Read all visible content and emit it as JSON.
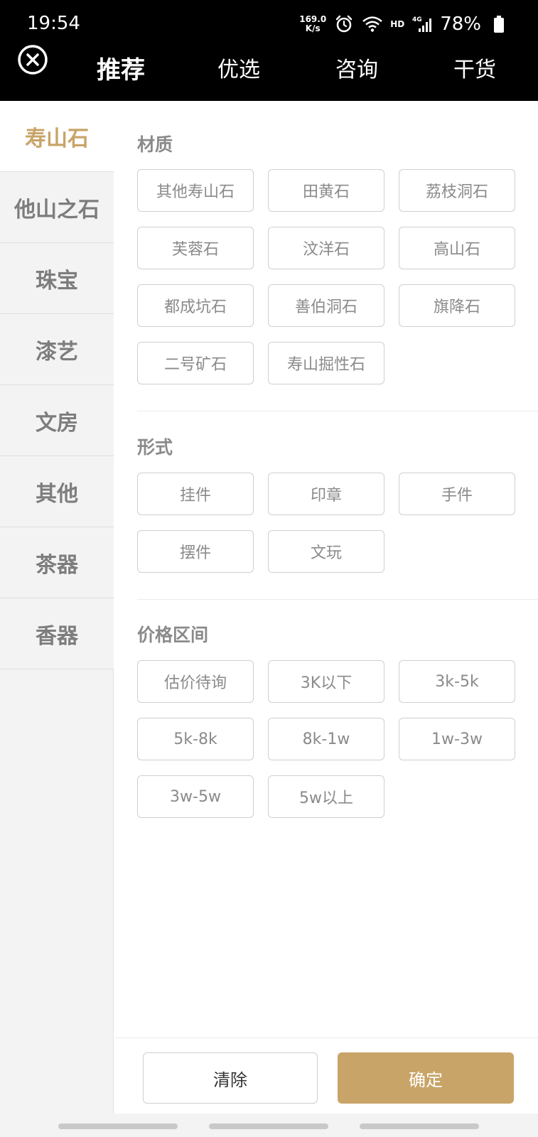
{
  "status_bar": {
    "time": "19:54",
    "net_speed_value": "169.0",
    "net_speed_unit": "K/s",
    "hd_label": "HD",
    "network_label": "4G",
    "battery": "78%",
    "icons": [
      "alarm-icon",
      "wifi-icon",
      "signal-icon",
      "battery-icon"
    ]
  },
  "nav": {
    "close_icon": "close-circle-icon",
    "tabs": [
      {
        "label": "推荐",
        "active": true
      },
      {
        "label": "优选",
        "active": false
      },
      {
        "label": "咨询",
        "active": false
      },
      {
        "label": "干货",
        "active": false
      }
    ]
  },
  "sidebar": {
    "active_color": "#c8a468",
    "items": [
      {
        "label": "寿山石",
        "active": true
      },
      {
        "label": "他山之石",
        "active": false
      },
      {
        "label": "珠宝",
        "active": false
      },
      {
        "label": "漆艺",
        "active": false
      },
      {
        "label": "文房",
        "active": false
      },
      {
        "label": "其他",
        "active": false
      },
      {
        "label": "茶器",
        "active": false
      },
      {
        "label": "香器",
        "active": false
      }
    ]
  },
  "filters": {
    "material": {
      "title": "材质",
      "options": [
        "其他寿山石",
        "田黄石",
        "荔枝洞石",
        "芙蓉石",
        "汶洋石",
        "高山石",
        "都成坑石",
        "善伯洞石",
        "旗降石",
        "二号矿石",
        "寿山掘性石"
      ]
    },
    "form": {
      "title": "形式",
      "options": [
        "挂件",
        "印章",
        "手件",
        "摆件",
        "文玩"
      ]
    },
    "price": {
      "title": "价格区间",
      "options": [
        "估价待询",
        "3K以下",
        "3k-5k",
        "5k-8k",
        "8k-1w",
        "1w-3w",
        "3w-5w",
        "5w以上"
      ]
    }
  },
  "footer": {
    "clear_label": "清除",
    "confirm_label": "确定",
    "confirm_color": "#c8a468"
  }
}
